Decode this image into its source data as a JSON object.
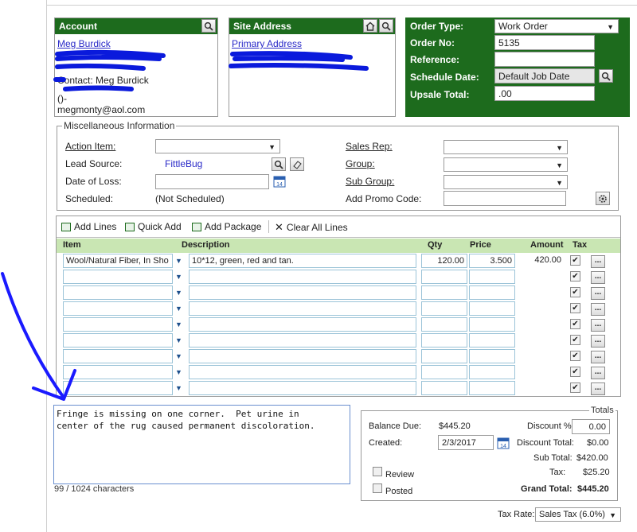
{
  "account": {
    "title": "Account",
    "name_link": "Meg Burdick",
    "contact_label": "Contact: Meg Burdick",
    "phone": "()-",
    "email": "megmonty@aol.com"
  },
  "site": {
    "title": "Site Address",
    "primary_link": "Primary Address"
  },
  "order": {
    "type_label": "Order Type:",
    "type_value": "Work Order",
    "no_label": "Order No:",
    "no_value": "5135",
    "reference_label": "Reference:",
    "reference_value": "",
    "schedule_label": "Schedule Date:",
    "schedule_value": "Default Job Date",
    "upsale_label": "Upsale Total:",
    "upsale_value": ".00"
  },
  "misc": {
    "legend": "Miscellaneous Information",
    "action_item_label": "Action Item:",
    "lead_source_label": "Lead Source:",
    "lead_source_value": "FittleBug",
    "date_of_loss_label": "Date of Loss:",
    "scheduled_label": "Scheduled:",
    "scheduled_value": "(Not Scheduled)",
    "sales_rep_label": "Sales Rep:",
    "group_label": "Group:",
    "sub_group_label": "Sub Group:",
    "promo_label": "Add Promo Code:"
  },
  "toolbar": {
    "add_lines": "Add Lines",
    "quick_add": "Quick Add",
    "add_package": "Add Package",
    "clear_all": "Clear All Lines"
  },
  "grid": {
    "headers": {
      "item": "Item",
      "description": "Description",
      "qty": "Qty",
      "price": "Price",
      "amount": "Amount",
      "tax": "Tax"
    },
    "rows": [
      {
        "item": "Wool/Natural Fiber, In Sho",
        "description": "10*12, green, red and tan.",
        "qty": "120.00",
        "price": "3.500",
        "amount": "420.00"
      },
      {
        "item": "",
        "description": "",
        "qty": "",
        "price": "",
        "amount": ""
      },
      {
        "item": "",
        "description": "",
        "qty": "",
        "price": "",
        "amount": ""
      },
      {
        "item": "",
        "description": "",
        "qty": "",
        "price": "",
        "amount": ""
      },
      {
        "item": "",
        "description": "",
        "qty": "",
        "price": "",
        "amount": ""
      },
      {
        "item": "",
        "description": "",
        "qty": "",
        "price": "",
        "amount": ""
      },
      {
        "item": "",
        "description": "",
        "qty": "",
        "price": "",
        "amount": ""
      },
      {
        "item": "",
        "description": "",
        "qty": "",
        "price": "",
        "amount": ""
      },
      {
        "item": "",
        "description": "",
        "qty": "",
        "price": "",
        "amount": ""
      }
    ]
  },
  "notes": {
    "text": "Fringe is missing on one corner.  Pet urine in\ncenter of the rug caused permanent discoloration.",
    "counter": "99 / 1024 characters"
  },
  "totals": {
    "legend": "Totals",
    "balance_due_label": "Balance Due:",
    "balance_due_value": "$445.20",
    "discount_pct_label": "Discount %:",
    "discount_pct_value": "0.00",
    "created_label": "Created:",
    "created_value": "2/3/2017",
    "discount_total_label": "Discount Total:",
    "discount_total_value": "$0.00",
    "sub_total_label": "Sub Total:",
    "sub_total_value": "$420.00",
    "tax_label": "Tax:",
    "tax_value": "$25.20",
    "review_label": "Review",
    "posted_label": "Posted",
    "grand_total_label": "Grand Total:",
    "grand_total_value": "$445.20"
  },
  "tax_rate": {
    "label": "Tax Rate:",
    "value": "Sales Tax (6.0%)"
  },
  "colors": {
    "header_green": "#1d6b1d",
    "grid_header": "#c9e6b3",
    "link": "#2a2ac8",
    "annotation_blue": "#1a1aff",
    "annotation_scribble": "#0a1adc"
  },
  "icons": {
    "search": "magnifier-icon",
    "home": "house-icon",
    "calendar": "calendar-icon",
    "eraser": "eraser-icon",
    "promo": "gear-icon"
  }
}
